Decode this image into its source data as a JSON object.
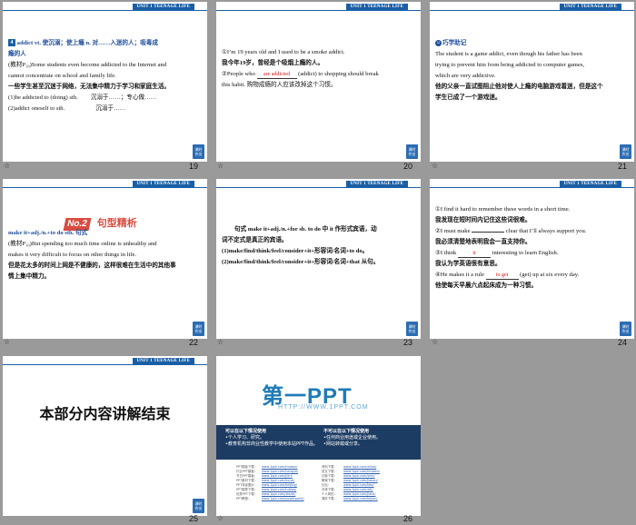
{
  "header_label": "UNIT 1  TEENAGE LIFE",
  "side_button": "课时\n作业",
  "star_icon": "☆",
  "slides": {
    "s19": {
      "page": "19",
      "badge": "4",
      "line1": "addict  vt. 使沉溺；使上瘾  n. 对……入迷的人；吸毒成",
      "line2": "瘾的人",
      "line3": "(教材P₁₀)Some students even become addicted to the Internet and",
      "line4": "cannot concentrate on school and family life.",
      "line5": "一些学生甚至沉迷于网络，无法集中精力于学习和家庭生活。",
      "line6a": "(1)be addicted to (doing) sth.",
      "line6b": "沉溺于……；专心做……",
      "line7a": "(2)addict oneself to sth.",
      "line7b": "沉溺于……"
    },
    "s20": {
      "page": "20",
      "l1": "①I’m 19 years old and I used to be a smoke addict.",
      "l2": "我今年19岁，曾经是个吸烟上瘾的人。",
      "l3a": "②People who ",
      "l3ans": "are addicted",
      "l3b": " (addict) to shopping should break",
      "l4": "this habit.  购物成瘾的人应该改掉这个习惯。"
    },
    "s21": {
      "page": "21",
      "tag": "巧学助记",
      "l1": "The student is a game addict, even though his father has been",
      "l2": "trying to prevent him from being addicted to computer games,",
      "l3": "which are very addictive.",
      "l4": "他的父亲一直试图阻止他对使人上瘾的电脑游戏着迷，但是这个",
      "l5": "学生已成了一个游戏迷。"
    },
    "s22": {
      "page": "22",
      "no": "No.2",
      "title": "句型精析",
      "l1": "make it+adj./n.+to do sth. 句式",
      "l2": "(教材P₁₀)But spending too much time online is unhealthy and",
      "l3": "makes it very difficult to focus on other things in life.",
      "l4": "但是花太多的时间上网是不健康的，这样很难在生活中的其他事",
      "l5": "情上集中精力。"
    },
    "s23": {
      "page": "23",
      "l1": "句式 make it+adj./n.+for sb. to do 中 it 作形式宾语，动",
      "l2": "词不定式是真正的宾语。",
      "l3": "(1)make/find/think/feel/consider+it+形容词/名词+to do。",
      "l4": "(2)make/find/think/feel/consider+it+形容词/名词+that 从句。"
    },
    "s24": {
      "page": "24",
      "l1": "①I find it hard to remember these words in a short time.",
      "l2": "我发现在短时间内记住这些词很难。",
      "l3a": "②I must make ",
      "l3ans": "",
      "l3b": " clear that I’ll always support you.",
      "l4": "我必须清楚地表明我会一直支持你。",
      "l5a": "③I think ",
      "l5ans": "it",
      "l5b": " interesting to learn English.",
      "l6": "我认为学英语很有意思。",
      "l7a": "④He makes it a rule ",
      "l7ans": "to get",
      "l7b": " (get) up at six every day.",
      "l8": "他使每天早晨六点起床成为一种习惯。"
    },
    "s25": {
      "page": "25",
      "title": "本部分内容讲解结束"
    },
    "s26": {
      "page": "26",
      "logo": "第一PPT",
      "url": "HTTP://WWW.1PPT.COM",
      "col1_title": "可以在以下情况使用",
      "col1_l1": "•个人学习、研究。",
      "col1_l2": "•教育机构非商业性教学中使用本站PPT作品。",
      "col2_title": "不可以在以下情况使用",
      "col2_l1": "•任何商业用途或企业使用。",
      "col2_l2": "•网站转载或分享。",
      "links_a": [
        "PPT模板下载：",
        "行业PPT模板：",
        "节日PPT模板：",
        "PPT素材下载：",
        "PPT背景图片：",
        "PPT图表下载：",
        "优秀PPT下载：",
        "PPT教程："
      ],
      "links_b": [
        "www.1ppt.com/moban/",
        "www.1ppt.com/hangye/",
        "www.1ppt.com/jieri/",
        "www.1ppt.com/sucai/",
        "www.1ppt.com/beijing/",
        "www.1ppt.com/tubiao/",
        "www.1ppt.com/xiazai/",
        "www.1ppt.com/powerpoint/"
      ],
      "links_c": [
        "资料下载：",
        "范文下载：",
        "试卷下载：",
        "教案下载：",
        "论坛：",
        "字体下载：",
        "个人简历：",
        "课件下载："
      ],
      "links_d": [
        "www.1ppt.com/ziliao/",
        "www.1ppt.com/fanwen/",
        "www.1ppt.com/shiti/",
        "www.1ppt.com/jiaoan/",
        "www.1ppt.com/bbs/",
        "www.1ppt.com/ziti/",
        "www.1ppt.com/jianli/",
        "www.1ppt.com/kejian/"
      ]
    }
  }
}
